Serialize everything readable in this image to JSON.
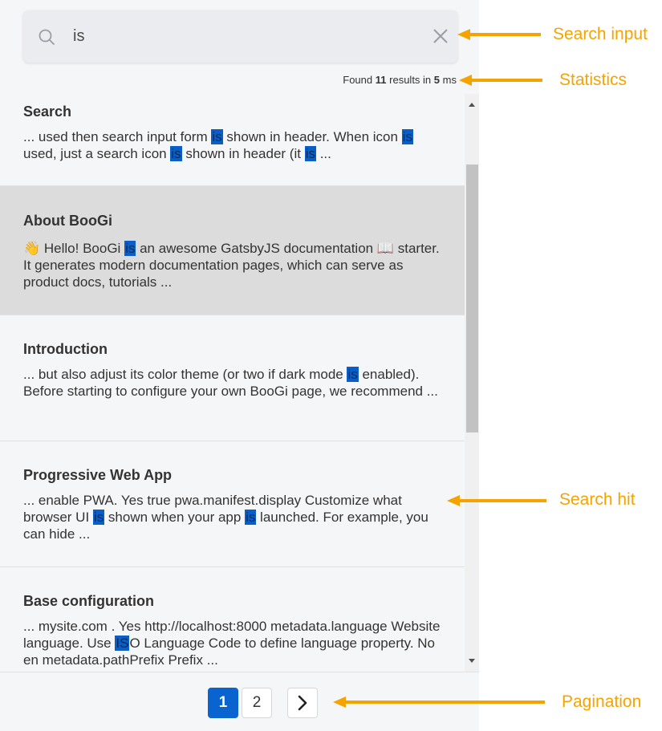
{
  "search": {
    "value": "is",
    "placeholder": ""
  },
  "stats": {
    "prefix": "Found",
    "count": "11",
    "middle": "results in",
    "time": "5",
    "suffix": "ms"
  },
  "hits": [
    {
      "title": "Search",
      "snippet": [
        {
          "t": "... used then search input form "
        },
        {
          "h": "is"
        },
        {
          "t": " shown in header. When icon "
        },
        {
          "h": "is"
        },
        {
          "t": " used, just a search icon "
        },
        {
          "h": "is"
        },
        {
          "t": " shown in header (it "
        },
        {
          "h": "is"
        },
        {
          "t": " ..."
        }
      ]
    },
    {
      "title": "About BooGi",
      "snippet": [
        {
          "t": "👋 Hello! BooGi "
        },
        {
          "h": "is"
        },
        {
          "t": " an awesome GatsbyJS documentation 📖 starter. It generates modern documentation pages, which can serve as product docs, tutorials ..."
        }
      ]
    },
    {
      "title": "Introduction",
      "snippet": [
        {
          "t": "... but also adjust its color theme (or two if dark mode "
        },
        {
          "h": "is"
        },
        {
          "t": " enabled). Before starting to configure your own BooGi page, we recommend ..."
        }
      ]
    },
    {
      "title": "Progressive Web App",
      "snippet": [
        {
          "t": "... enable PWA. Yes true pwa.manifest.display Customize what browser UI "
        },
        {
          "h": "is"
        },
        {
          "t": " shown when your app "
        },
        {
          "h": "is"
        },
        {
          "t": " launched. For example, you can hide ..."
        }
      ]
    },
    {
      "title": "Base configuration",
      "snippet": [
        {
          "t": "... mysite.com . Yes http://localhost:8000 metadata.language Website language. Use "
        },
        {
          "h": "IS"
        },
        {
          "t": "O Language Code to define language property. No en metadata.pathPrefix Prefix ..."
        }
      ]
    }
  ],
  "active_hit": 1,
  "pagination": {
    "pages": [
      "1",
      "2"
    ],
    "current": "1",
    "next": "›"
  },
  "annotations": {
    "search_input": "Search input",
    "statistics": "Statistics",
    "search_hit": "Search hit",
    "pagination": "Pagination"
  },
  "colors": {
    "accent": "#0a64d0",
    "highlight": "#0a5ec7",
    "annotation": "#f5a300",
    "active_hit_bg": "#dcdcdd"
  }
}
